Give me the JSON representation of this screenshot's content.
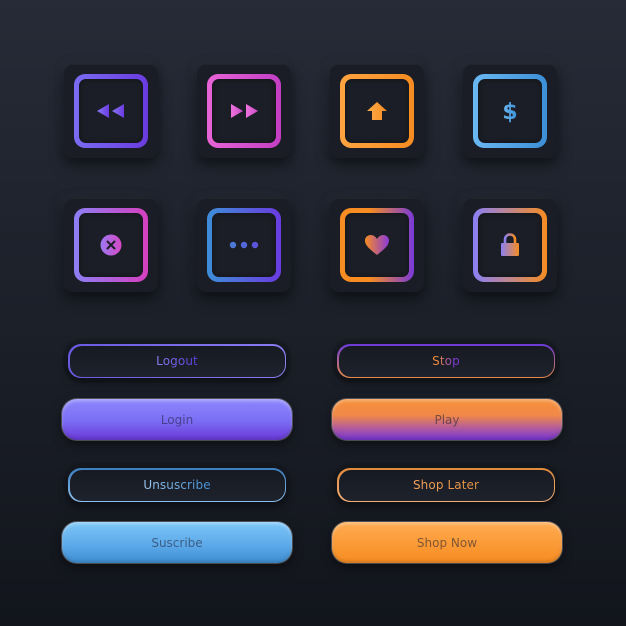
{
  "icon_tiles": [
    {
      "name": "rewind",
      "icon": "rewind-icon",
      "gradient": [
        "#7a6cf2",
        "#6a3be0"
      ],
      "icon_colors": [
        "#8a78f5",
        "#6a3be0"
      ]
    },
    {
      "name": "fast-forward",
      "icon": "fast-forward-icon",
      "gradient": [
        "#e764d6",
        "#c33ec4"
      ],
      "icon_colors": [
        "#e96cd8",
        "#c84ac8"
      ]
    },
    {
      "name": "home",
      "icon": "home-arrow-icon",
      "gradient": [
        "#ffa340",
        "#f68c22"
      ],
      "icon_colors": [
        "#ffa340",
        "#f68c22"
      ]
    },
    {
      "name": "dollar",
      "icon": "dollar-icon",
      "gradient": [
        "#6ab8f2",
        "#3c8fd6"
      ],
      "icon_colors": [
        "#6ab8f2",
        "#3c8fd6"
      ]
    },
    {
      "name": "close",
      "icon": "close-circle-icon",
      "gradient": [
        "#8d7ff5",
        "#d53fbe"
      ],
      "icon_colors": [
        "#9c78f2",
        "#d548c4"
      ]
    },
    {
      "name": "more",
      "icon": "more-dots-icon",
      "gradient": [
        "#3d8ed8",
        "#6a3be0"
      ],
      "icon_colors": [
        "#4d78d8",
        "#5c56de"
      ]
    },
    {
      "name": "favorite",
      "icon": "heart-icon",
      "gradient": [
        "#f68c22",
        "#7a3ad8"
      ],
      "icon_colors": [
        "#f68c22",
        "#8a3ad8"
      ]
    },
    {
      "name": "lock",
      "icon": "lock-icon",
      "gradient": [
        "#8a80f5",
        "#f68c22"
      ],
      "icon_colors": [
        "#8a80f5",
        "#f68c22"
      ]
    }
  ],
  "buttons": {
    "logout": {
      "label": "Logout",
      "style": "outline",
      "colors": [
        "#5a4ad8",
        "#8a7cf0"
      ]
    },
    "stop": {
      "label": "Stop",
      "style": "outline",
      "colors": [
        "#f08a3a",
        "#7a3ad8"
      ]
    },
    "login": {
      "label": "Login",
      "style": "filled",
      "colors": [
        "#8c86fb",
        "#6a38d8"
      ]
    },
    "play": {
      "label": "Play",
      "style": "filled",
      "colors": [
        "#f7913a",
        "#7534d4"
      ]
    },
    "unsubscribe": {
      "label": "Unsuscribe",
      "style": "outline",
      "colors": [
        "#8ec0ee",
        "#3c8fd6"
      ]
    },
    "shop_later": {
      "label": "Shop Later",
      "style": "outline",
      "colors": [
        "#f5a25a",
        "#e08a3a"
      ]
    },
    "subscribe": {
      "label": "Suscribe",
      "style": "filled",
      "colors": [
        "#74c0f7",
        "#3e8ed2"
      ]
    },
    "shop_now": {
      "label": "Shop Now",
      "style": "filled",
      "colors": [
        "#ffa54a",
        "#f68c22"
      ]
    }
  }
}
